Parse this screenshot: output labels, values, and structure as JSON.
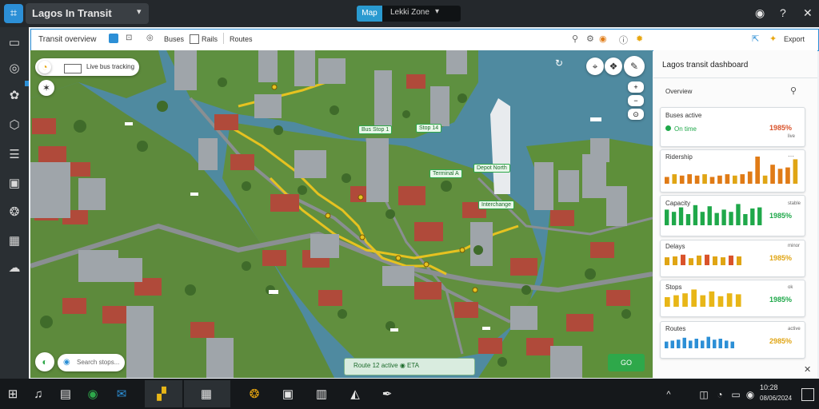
{
  "window": {
    "title": "Lagos In Transit"
  },
  "top_center": {
    "tab_label": "Map",
    "value": "Lekki Zone"
  },
  "top_right": {
    "help_icon": "help-icon",
    "close_icon": "close-icon"
  },
  "toolbar": {
    "breadcrumb": "Transit overview",
    "layer_label": "Buses",
    "layer2_label": "Rails",
    "mode_label": "Routes",
    "right_action_label": "Export"
  },
  "map": {
    "route_chip_label": "Live bus tracking",
    "search_placeholder": "Search stops...",
    "zoom_in_icon": "+",
    "zoom_out_icon": "−",
    "bottom_pill_text": "Route 12 active  ◉  ETA",
    "confirm_label": "GO",
    "poi_labels": [
      "Bus Stop 1",
      "Terminal A",
      "Depot North",
      "Stop 14",
      "Interchange"
    ]
  },
  "panel": {
    "header": "Lagos transit dashboard",
    "search_label": "Overview",
    "cards": [
      {
        "title": "Buses active",
        "status": "On time",
        "value": "1985%",
        "sub": "live",
        "color": "#1fa84a",
        "bars": []
      },
      {
        "title": "Ridership",
        "value": "",
        "sub": "",
        "color": "#e07b16",
        "bars": [
          0.25,
          0.35,
          0.3,
          0.35,
          0.3,
          0.35,
          0.25,
          0.3,
          0.35,
          0.3,
          0.35,
          0.45,
          1.0,
          0.3,
          0.7,
          0.55,
          0.6,
          0.9
        ]
      },
      {
        "title": "Capacity",
        "value": "1985%",
        "sub": "stable",
        "color": "#1fa84a",
        "bars": [
          0.7,
          0.6,
          0.8,
          0.5,
          0.9,
          0.6,
          0.85,
          0.55,
          0.7,
          0.6,
          0.95,
          0.5,
          0.75,
          0.8
        ]
      },
      {
        "title": "Delays",
        "value": "1985%",
        "sub": "minor",
        "color": "#e0a514",
        "bars": [
          0.45,
          0.5,
          0.6,
          0.4,
          0.55,
          0.6,
          0.5,
          0.45,
          0.55,
          0.5
        ]
      },
      {
        "title": "Stops",
        "value": "1985%",
        "sub": "ok",
        "color": "#e8b617",
        "bars": [
          0.5,
          0.6,
          0.7,
          0.9,
          0.6,
          0.8,
          0.55,
          0.7,
          0.65
        ]
      },
      {
        "title": "Routes",
        "value": "2985%",
        "sub": "active",
        "color": "#2c8fd6",
        "bars": [
          0.35,
          0.4,
          0.45,
          0.55,
          0.4,
          0.5,
          0.4,
          0.6,
          0.45,
          0.5,
          0.4,
          0.35
        ]
      }
    ]
  },
  "taskbar": {
    "clock_time": "10:28",
    "clock_date": "08/06/2024"
  },
  "colors": {
    "accent": "#2c8fd6",
    "water": "#4f8aa0",
    "grass": "#5e8f3a",
    "road": "#8a8f92",
    "route": "#e6c220"
  }
}
